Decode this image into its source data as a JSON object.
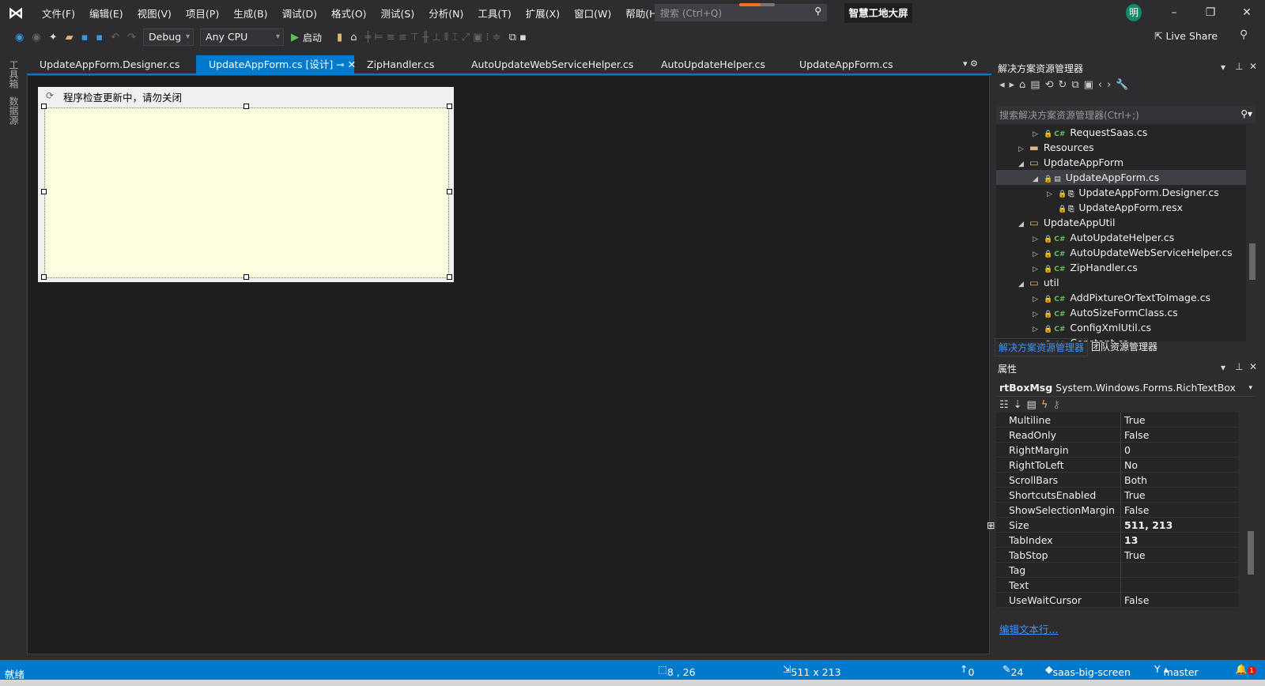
{
  "menu": {
    "items": [
      "文件(F)",
      "编辑(E)",
      "视图(V)",
      "项目(P)",
      "生成(B)",
      "调试(D)",
      "格式(O)",
      "测试(S)",
      "分析(N)",
      "工具(T)",
      "扩展(X)",
      "窗口(W)",
      "帮助(H)"
    ],
    "search_placeholder": "搜索 (Ctrl+Q)",
    "solution_name": "智慧工地大屏",
    "avatar": "明"
  },
  "toolbar": {
    "config": "Debug",
    "platform": "Any CPU",
    "start": "启动",
    "live_share": "Live Share"
  },
  "left_strip": {
    "toolbox": "工具箱",
    "datasource": "数据源"
  },
  "tabs": [
    {
      "label": "UpdateAppForm.Designer.cs"
    },
    {
      "label": "UpdateAppForm.cs [设计]",
      "active": true
    },
    {
      "label": "ZipHandler.cs"
    },
    {
      "label": "AutoUpdateWebServiceHelper.cs"
    },
    {
      "label": "AutoUpdateHelper.cs"
    },
    {
      "label": "UpdateAppForm.cs"
    }
  ],
  "designer": {
    "form_title": "程序检查更新中，请勿关闭"
  },
  "solution_explorer": {
    "title": "解决方案资源管理器",
    "search_placeholder": "搜索解决方案资源管理器(Ctrl+;)",
    "items": [
      {
        "label": "RequestSaas.cs",
        "indent": 2,
        "type": "cs",
        "expand": "▷"
      },
      {
        "label": "Resources",
        "indent": 1,
        "type": "folder",
        "expand": "▷"
      },
      {
        "label": "UpdateAppForm",
        "indent": 1,
        "type": "folder-open",
        "expand": "◢"
      },
      {
        "label": "UpdateAppForm.cs",
        "indent": 2,
        "type": "form",
        "expand": "◢",
        "selected": true
      },
      {
        "label": "UpdateAppForm.Designer.cs",
        "indent": 3,
        "type": "file",
        "expand": "▷"
      },
      {
        "label": "UpdateAppForm.resx",
        "indent": 3,
        "type": "file",
        "expand": ""
      },
      {
        "label": "UpdateAppUtil",
        "indent": 1,
        "type": "folder-open",
        "expand": "◢"
      },
      {
        "label": "AutoUpdateHelper.cs",
        "indent": 2,
        "type": "cs",
        "expand": "▷"
      },
      {
        "label": "AutoUpdateWebServiceHelper.cs",
        "indent": 2,
        "type": "cs",
        "expand": "▷"
      },
      {
        "label": "ZipHandler.cs",
        "indent": 2,
        "type": "cs",
        "expand": "▷"
      },
      {
        "label": "util",
        "indent": 1,
        "type": "folder-open",
        "expand": "◢"
      },
      {
        "label": "AddPixtureOrTextToImage.cs",
        "indent": 2,
        "type": "cs",
        "expand": "▷"
      },
      {
        "label": "AutoSizeFormClass.cs",
        "indent": 2,
        "type": "cs",
        "expand": "▷"
      },
      {
        "label": "ConfigXmlUtil.cs",
        "indent": 2,
        "type": "cs",
        "expand": "▷"
      },
      {
        "label": "Constant.cs",
        "indent": 2,
        "type": "cs",
        "expand": "▷"
      }
    ],
    "bottom_tabs": [
      "解决方案资源管理器",
      "团队资源管理器"
    ]
  },
  "properties": {
    "title": "属性",
    "object_name": "rtBoxMsg",
    "object_type": "System.Windows.Forms.RichTextBox",
    "rows": [
      {
        "name": "Multiline",
        "value": "True"
      },
      {
        "name": "ReadOnly",
        "value": "False"
      },
      {
        "name": "RightMargin",
        "value": "0"
      },
      {
        "name": "RightToLeft",
        "value": "No"
      },
      {
        "name": "ScrollBars",
        "value": "Both"
      },
      {
        "name": "ShortcutsEnabled",
        "value": "True"
      },
      {
        "name": "ShowSelectionMargin",
        "value": "False"
      },
      {
        "name": "Size",
        "value": "511, 213",
        "bold": true,
        "expandable": true
      },
      {
        "name": "TabIndex",
        "value": "13",
        "bold": true
      },
      {
        "name": "TabStop",
        "value": "True"
      },
      {
        "name": "Tag",
        "value": ""
      },
      {
        "name": "Text",
        "value": ""
      },
      {
        "name": "UseWaitCursor",
        "value": "False"
      }
    ],
    "edit_link": "编辑文本行..."
  },
  "status": {
    "ready": "就绪",
    "position": "8 , 26",
    "size": "511 x 213",
    "up": "0",
    "edits": "24",
    "repo": "saas-big-screen",
    "branch": "master",
    "notifications": "1"
  },
  "colors": {
    "accent": "#007acc",
    "background": "#2d2d30",
    "editor": "#1e1e1e",
    "richtextbox": "#ffffe1"
  }
}
